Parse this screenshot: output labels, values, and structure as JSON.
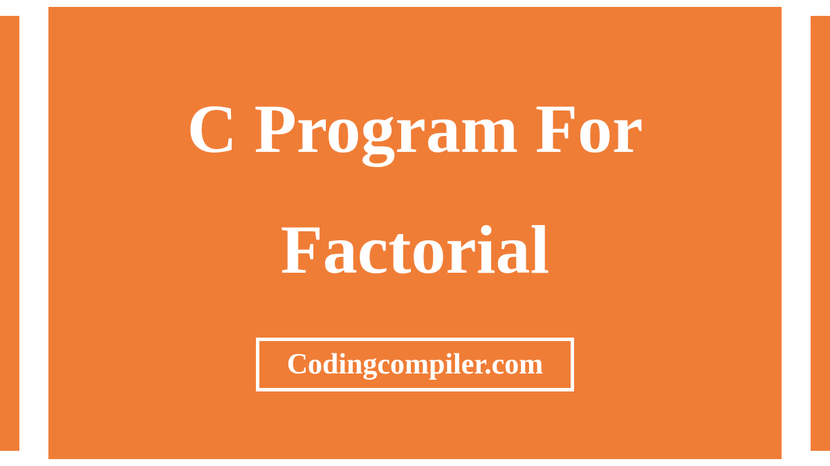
{
  "colors": {
    "accent": "#f07d36",
    "text": "#ffffff",
    "background": "#ffffff"
  },
  "title": {
    "line1": "C Program For",
    "line2": "Factorial"
  },
  "domain": "Codingcompiler.com"
}
